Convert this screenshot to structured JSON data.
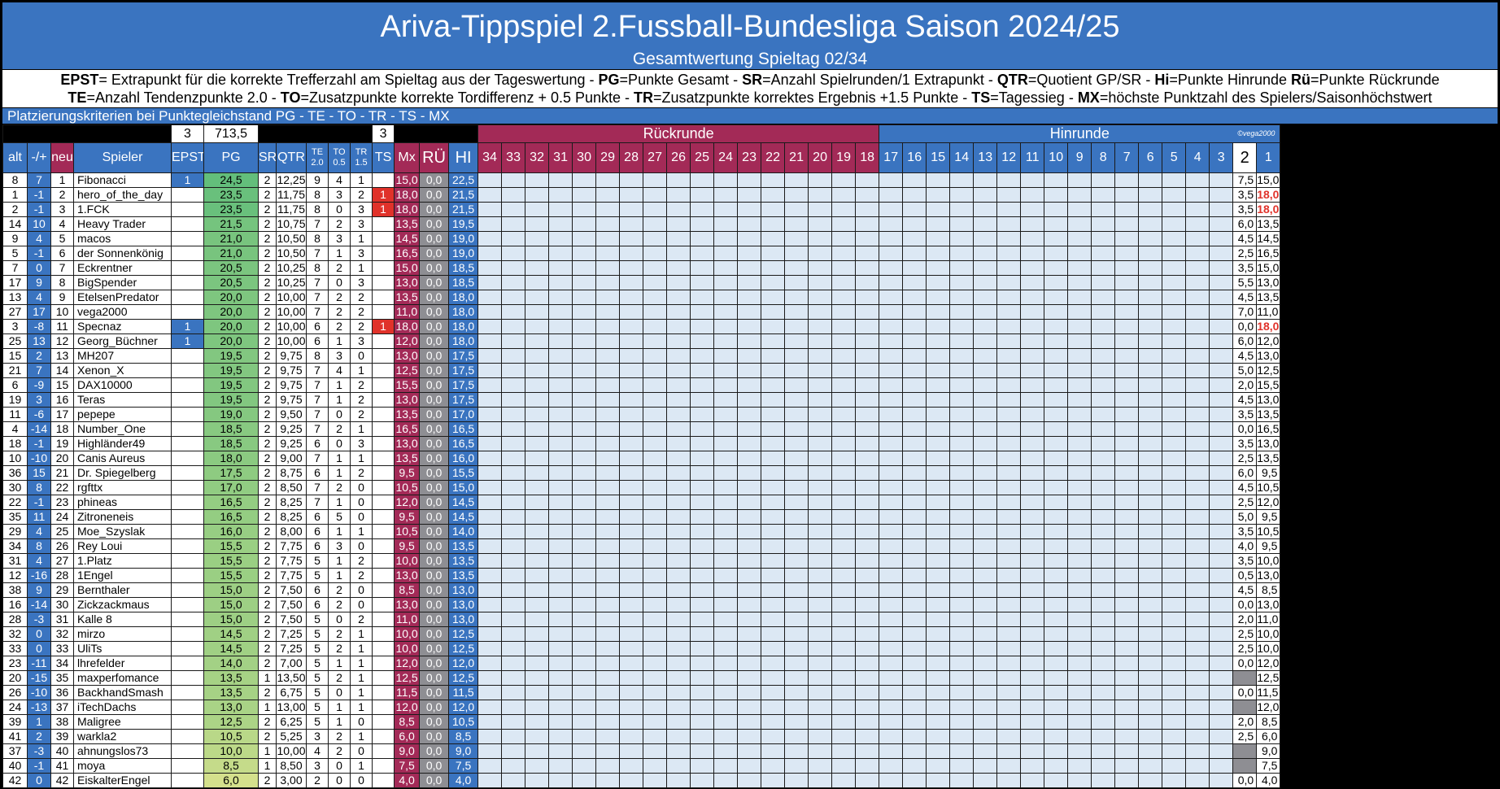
{
  "title": "Ariva-Tippspiel 2.Fussball-Bundesliga Saison 2024/25",
  "subtitle": "Gesamtwertung Spieltag 02/34",
  "legend_line1": [
    {
      "b": "EPST",
      "t": "= Extrapunkt für die korrekte Trefferzahl am Spieltag aus der Tageswertung - "
    },
    {
      "b": "PG",
      "t": "=Punkte Gesamt - "
    },
    {
      "b": "SR",
      "t": "=Anzahl Spielrunden/1 Extrapunkt - "
    },
    {
      "b": "QTR",
      "t": "=Quotient GP/SR - "
    },
    {
      "b": "Hi",
      "t": "=Punkte Hinrunde  "
    },
    {
      "b": "Rü",
      "t": "=Punkte Rückrunde"
    }
  ],
  "legend_line2": [
    {
      "b": "TE",
      "t": "=Anzahl Tendenzpunkte 2.0 - "
    },
    {
      "b": "TO",
      "t": "=Zusatzpunkte korrekte Tordifferenz + 0.5 Punkte - "
    },
    {
      "b": "TR",
      "t": "=Zusatzpunkte korrektes Ergebnis +1.5 Punkte - "
    },
    {
      "b": "TS",
      "t": "=Tagessieg - "
    },
    {
      "b": "MX",
      "t": "=höchste Punktzahl des Spielers/Saisonhöchstwert"
    }
  ],
  "criteria": "Platzierungskriterien bei Punktegleichstand  PG - TE - TO - TR - TS - MX",
  "totals": {
    "epst": "3",
    "pg": "713,5",
    "ts": "3",
    "rueckrunde": "Rückrunde",
    "hinrunde": "Hinrunde",
    "credit": "©vega2000"
  },
  "headers": {
    "alt": "alt",
    "pm": "-/+",
    "neu": "neu",
    "spieler": "Spieler",
    "epst": "EPST",
    "pg": "PG",
    "sr": "SR",
    "qtr": "QTR",
    "te_a": "TE",
    "te_b": "2.0",
    "to_a": "TO",
    "to_b": "0.5",
    "tr_a": "TR",
    "tr_b": "1.5",
    "ts": "TS",
    "mx": "Mx",
    "ru": "RÜ",
    "hi": "HI",
    "rounds_r": [
      "34",
      "33",
      "32",
      "31",
      "30",
      "29",
      "28",
      "27",
      "26",
      "25",
      "24",
      "23",
      "22",
      "21",
      "20",
      "19",
      "18"
    ],
    "rounds_h": [
      "17",
      "16",
      "15",
      "14",
      "13",
      "12",
      "11",
      "10",
      "9",
      "8",
      "7",
      "6",
      "5",
      "4",
      "3"
    ],
    "cur": "2",
    "one": "1"
  },
  "colors": {
    "blue": "#3a74c0",
    "maroon": "#a32a57",
    "gray": "#8e8e93",
    "red": "#e0322a",
    "light": "#dce8f4"
  },
  "rows": [
    {
      "alt": "8",
      "pm": "7",
      "neu": "1",
      "name": "Fibonacci",
      "epst": "1",
      "pg": "24,5",
      "sr": "2",
      "qtr": "12,25",
      "te": "9",
      "to": "4",
      "tr": "1",
      "ts": "",
      "mx": "15,0",
      "ru": "0,0",
      "hi": "22,5",
      "g2": "7,5",
      "g1": "15,0"
    },
    {
      "alt": "1",
      "pm": "-1",
      "neu": "2",
      "name": "hero_of_the_day",
      "epst": "",
      "pg": "23,5",
      "sr": "2",
      "qtr": "11,75",
      "te": "8",
      "to": "3",
      "tr": "2",
      "ts": "1",
      "mx": "18,0",
      "ru": "0,0",
      "hi": "21,5",
      "g2": "3,5",
      "g1": "18,0"
    },
    {
      "alt": "2",
      "pm": "-1",
      "neu": "3",
      "name": "1.FCK",
      "epst": "",
      "pg": "23,5",
      "sr": "2",
      "qtr": "11,75",
      "te": "8",
      "to": "0",
      "tr": "3",
      "ts": "1",
      "mx": "18,0",
      "ru": "0,0",
      "hi": "21,5",
      "g2": "3,5",
      "g1": "18,0"
    },
    {
      "alt": "14",
      "pm": "10",
      "neu": "4",
      "name": "Heavy Trader",
      "epst": "",
      "pg": "21,5",
      "sr": "2",
      "qtr": "10,75",
      "te": "7",
      "to": "2",
      "tr": "3",
      "ts": "",
      "mx": "13,5",
      "ru": "0,0",
      "hi": "19,5",
      "g2": "6,0",
      "g1": "13,5"
    },
    {
      "alt": "9",
      "pm": "4",
      "neu": "5",
      "name": "macos",
      "epst": "",
      "pg": "21,0",
      "sr": "2",
      "qtr": "10,50",
      "te": "8",
      "to": "3",
      "tr": "1",
      "ts": "",
      "mx": "14,5",
      "ru": "0,0",
      "hi": "19,0",
      "g2": "4,5",
      "g1": "14,5"
    },
    {
      "alt": "5",
      "pm": "-1",
      "neu": "6",
      "name": "der Sonnenkönig",
      "epst": "",
      "pg": "21,0",
      "sr": "2",
      "qtr": "10,50",
      "te": "7",
      "to": "1",
      "tr": "3",
      "ts": "",
      "mx": "16,5",
      "ru": "0,0",
      "hi": "19,0",
      "g2": "2,5",
      "g1": "16,5"
    },
    {
      "alt": "7",
      "pm": "0",
      "neu": "7",
      "name": "Eckrentner",
      "epst": "",
      "pg": "20,5",
      "sr": "2",
      "qtr": "10,25",
      "te": "8",
      "to": "2",
      "tr": "1",
      "ts": "",
      "mx": "15,0",
      "ru": "0,0",
      "hi": "18,5",
      "g2": "3,5",
      "g1": "15,0"
    },
    {
      "alt": "17",
      "pm": "9",
      "neu": "8",
      "name": "BigSpender",
      "epst": "",
      "pg": "20,5",
      "sr": "2",
      "qtr": "10,25",
      "te": "7",
      "to": "0",
      "tr": "3",
      "ts": "",
      "mx": "13,0",
      "ru": "0,0",
      "hi": "18,5",
      "g2": "5,5",
      "g1": "13,0"
    },
    {
      "alt": "13",
      "pm": "4",
      "neu": "9",
      "name": "EtelsenPredator",
      "epst": "",
      "pg": "20,0",
      "sr": "2",
      "qtr": "10,00",
      "te": "7",
      "to": "2",
      "tr": "2",
      "ts": "",
      "mx": "13,5",
      "ru": "0,0",
      "hi": "18,0",
      "g2": "4,5",
      "g1": "13,5"
    },
    {
      "alt": "27",
      "pm": "17",
      "neu": "10",
      "name": "vega2000",
      "epst": "",
      "pg": "20,0",
      "sr": "2",
      "qtr": "10,00",
      "te": "7",
      "to": "2",
      "tr": "2",
      "ts": "",
      "mx": "11,0",
      "ru": "0,0",
      "hi": "18,0",
      "g2": "7,0",
      "g1": "11,0"
    },
    {
      "alt": "3",
      "pm": "-8",
      "neu": "11",
      "name": "Specnaz",
      "epst": "1",
      "pg": "20,0",
      "sr": "2",
      "qtr": "10,00",
      "te": "6",
      "to": "2",
      "tr": "2",
      "ts": "1",
      "mx": "18,0",
      "ru": "0,0",
      "hi": "18,0",
      "g2": "0,0",
      "g1": "18,0"
    },
    {
      "alt": "25",
      "pm": "13",
      "neu": "12",
      "name": "Georg_Büchner",
      "epst": "1",
      "pg": "20,0",
      "sr": "2",
      "qtr": "10,00",
      "te": "6",
      "to": "1",
      "tr": "3",
      "ts": "",
      "mx": "12,0",
      "ru": "0,0",
      "hi": "18,0",
      "g2": "6,0",
      "g1": "12,0"
    },
    {
      "alt": "15",
      "pm": "2",
      "neu": "13",
      "name": "MH207",
      "epst": "",
      "pg": "19,5",
      "sr": "2",
      "qtr": "9,75",
      "te": "8",
      "to": "3",
      "tr": "0",
      "ts": "",
      "mx": "13,0",
      "ru": "0,0",
      "hi": "17,5",
      "g2": "4,5",
      "g1": "13,0"
    },
    {
      "alt": "21",
      "pm": "7",
      "neu": "14",
      "name": "Xenon_X",
      "epst": "",
      "pg": "19,5",
      "sr": "2",
      "qtr": "9,75",
      "te": "7",
      "to": "4",
      "tr": "1",
      "ts": "",
      "mx": "12,5",
      "ru": "0,0",
      "hi": "17,5",
      "g2": "5,0",
      "g1": "12,5"
    },
    {
      "alt": "6",
      "pm": "-9",
      "neu": "15",
      "name": "DAX10000",
      "epst": "",
      "pg": "19,5",
      "sr": "2",
      "qtr": "9,75",
      "te": "7",
      "to": "1",
      "tr": "2",
      "ts": "",
      "mx": "15,5",
      "ru": "0,0",
      "hi": "17,5",
      "g2": "2,0",
      "g1": "15,5"
    },
    {
      "alt": "19",
      "pm": "3",
      "neu": "16",
      "name": "Teras",
      "epst": "",
      "pg": "19,5",
      "sr": "2",
      "qtr": "9,75",
      "te": "7",
      "to": "1",
      "tr": "2",
      "ts": "",
      "mx": "13,0",
      "ru": "0,0",
      "hi": "17,5",
      "g2": "4,5",
      "g1": "13,0"
    },
    {
      "alt": "11",
      "pm": "-6",
      "neu": "17",
      "name": "pepepe",
      "epst": "",
      "pg": "19,0",
      "sr": "2",
      "qtr": "9,50",
      "te": "7",
      "to": "0",
      "tr": "2",
      "ts": "",
      "mx": "13,5",
      "ru": "0,0",
      "hi": "17,0",
      "g2": "3,5",
      "g1": "13,5"
    },
    {
      "alt": "4",
      "pm": "-14",
      "neu": "18",
      "name": "Number_One",
      "epst": "",
      "pg": "18,5",
      "sr": "2",
      "qtr": "9,25",
      "te": "7",
      "to": "2",
      "tr": "1",
      "ts": "",
      "mx": "16,5",
      "ru": "0,0",
      "hi": "16,5",
      "g2": "0,0",
      "g1": "16,5"
    },
    {
      "alt": "18",
      "pm": "-1",
      "neu": "19",
      "name": "Highländer49",
      "epst": "",
      "pg": "18,5",
      "sr": "2",
      "qtr": "9,25",
      "te": "6",
      "to": "0",
      "tr": "3",
      "ts": "",
      "mx": "13,0",
      "ru": "0,0",
      "hi": "16,5",
      "g2": "3,5",
      "g1": "13,0"
    },
    {
      "alt": "10",
      "pm": "-10",
      "neu": "20",
      "name": "Canis Aureus",
      "epst": "",
      "pg": "18,0",
      "sr": "2",
      "qtr": "9,00",
      "te": "7",
      "to": "1",
      "tr": "1",
      "ts": "",
      "mx": "13,5",
      "ru": "0,0",
      "hi": "16,0",
      "g2": "2,5",
      "g1": "13,5"
    },
    {
      "alt": "36",
      "pm": "15",
      "neu": "21",
      "name": "Dr. Spiegelberg",
      "epst": "",
      "pg": "17,5",
      "sr": "2",
      "qtr": "8,75",
      "te": "6",
      "to": "1",
      "tr": "2",
      "ts": "",
      "mx": "9,5",
      "ru": "0,0",
      "hi": "15,5",
      "g2": "6,0",
      "g1": "9,5"
    },
    {
      "alt": "30",
      "pm": "8",
      "neu": "22",
      "name": "rgfttx",
      "epst": "",
      "pg": "17,0",
      "sr": "2",
      "qtr": "8,50",
      "te": "7",
      "to": "2",
      "tr": "0",
      "ts": "",
      "mx": "10,5",
      "ru": "0,0",
      "hi": "15,0",
      "g2": "4,5",
      "g1": "10,5"
    },
    {
      "alt": "22",
      "pm": "-1",
      "neu": "23",
      "name": "phineas",
      "epst": "",
      "pg": "16,5",
      "sr": "2",
      "qtr": "8,25",
      "te": "7",
      "to": "1",
      "tr": "0",
      "ts": "",
      "mx": "12,0",
      "ru": "0,0",
      "hi": "14,5",
      "g2": "2,5",
      "g1": "12,0"
    },
    {
      "alt": "35",
      "pm": "11",
      "neu": "24",
      "name": "Zitroneneis",
      "epst": "",
      "pg": "16,5",
      "sr": "2",
      "qtr": "8,25",
      "te": "6",
      "to": "5",
      "tr": "0",
      "ts": "",
      "mx": "9,5",
      "ru": "0,0",
      "hi": "14,5",
      "g2": "5,0",
      "g1": "9,5"
    },
    {
      "alt": "29",
      "pm": "4",
      "neu": "25",
      "name": "Moe_Szyslak",
      "epst": "",
      "pg": "16,0",
      "sr": "2",
      "qtr": "8,00",
      "te": "6",
      "to": "1",
      "tr": "1",
      "ts": "",
      "mx": "10,5",
      "ru": "0,0",
      "hi": "14,0",
      "g2": "3,5",
      "g1": "10,5"
    },
    {
      "alt": "34",
      "pm": "8",
      "neu": "26",
      "name": "Rey Loui",
      "epst": "",
      "pg": "15,5",
      "sr": "2",
      "qtr": "7,75",
      "te": "6",
      "to": "3",
      "tr": "0",
      "ts": "",
      "mx": "9,5",
      "ru": "0,0",
      "hi": "13,5",
      "g2": "4,0",
      "g1": "9,5"
    },
    {
      "alt": "31",
      "pm": "4",
      "neu": "27",
      "name": "1.Platz",
      "epst": "",
      "pg": "15,5",
      "sr": "2",
      "qtr": "7,75",
      "te": "5",
      "to": "1",
      "tr": "2",
      "ts": "",
      "mx": "10,0",
      "ru": "0,0",
      "hi": "13,5",
      "g2": "3,5",
      "g1": "10,0"
    },
    {
      "alt": "12",
      "pm": "-16",
      "neu": "28",
      "name": "1Engel",
      "epst": "",
      "pg": "15,5",
      "sr": "2",
      "qtr": "7,75",
      "te": "5",
      "to": "1",
      "tr": "2",
      "ts": "",
      "mx": "13,0",
      "ru": "0,0",
      "hi": "13,5",
      "g2": "0,5",
      "g1": "13,0"
    },
    {
      "alt": "38",
      "pm": "9",
      "neu": "29",
      "name": "Bernthaler",
      "epst": "",
      "pg": "15,0",
      "sr": "2",
      "qtr": "7,50",
      "te": "6",
      "to": "2",
      "tr": "0",
      "ts": "",
      "mx": "8,5",
      "ru": "0,0",
      "hi": "13,0",
      "g2": "4,5",
      "g1": "8,5"
    },
    {
      "alt": "16",
      "pm": "-14",
      "neu": "30",
      "name": "Zickzackmaus",
      "epst": "",
      "pg": "15,0",
      "sr": "2",
      "qtr": "7,50",
      "te": "6",
      "to": "2",
      "tr": "0",
      "ts": "",
      "mx": "13,0",
      "ru": "0,0",
      "hi": "13,0",
      "g2": "0,0",
      "g1": "13,0"
    },
    {
      "alt": "28",
      "pm": "-3",
      "neu": "31",
      "name": "Kalle 8",
      "epst": "",
      "pg": "15,0",
      "sr": "2",
      "qtr": "7,50",
      "te": "5",
      "to": "0",
      "tr": "2",
      "ts": "",
      "mx": "11,0",
      "ru": "0,0",
      "hi": "13,0",
      "g2": "2,0",
      "g1": "11,0"
    },
    {
      "alt": "32",
      "pm": "0",
      "neu": "32",
      "name": "mirzo",
      "epst": "",
      "pg": "14,5",
      "sr": "2",
      "qtr": "7,25",
      "te": "5",
      "to": "2",
      "tr": "1",
      "ts": "",
      "mx": "10,0",
      "ru": "0,0",
      "hi": "12,5",
      "g2": "2,5",
      "g1": "10,0"
    },
    {
      "alt": "33",
      "pm": "0",
      "neu": "33",
      "name": "UliTs",
      "epst": "",
      "pg": "14,5",
      "sr": "2",
      "qtr": "7,25",
      "te": "5",
      "to": "2",
      "tr": "1",
      "ts": "",
      "mx": "10,0",
      "ru": "0,0",
      "hi": "12,5",
      "g2": "2,5",
      "g1": "10,0"
    },
    {
      "alt": "23",
      "pm": "-11",
      "neu": "34",
      "name": "lhrefelder",
      "epst": "",
      "pg": "14,0",
      "sr": "2",
      "qtr": "7,00",
      "te": "5",
      "to": "1",
      "tr": "1",
      "ts": "",
      "mx": "12,0",
      "ru": "0,0",
      "hi": "12,0",
      "g2": "0,0",
      "g1": "12,0"
    },
    {
      "alt": "20",
      "pm": "-15",
      "neu": "35",
      "name": "maxperfomance",
      "epst": "",
      "pg": "13,5",
      "sr": "1",
      "qtr": "13,50",
      "te": "5",
      "to": "2",
      "tr": "1",
      "ts": "",
      "mx": "12,5",
      "ru": "0,0",
      "hi": "12,5",
      "g2": "",
      "g1": "12,5"
    },
    {
      "alt": "26",
      "pm": "-10",
      "neu": "36",
      "name": "BackhandSmash",
      "epst": "",
      "pg": "13,5",
      "sr": "2",
      "qtr": "6,75",
      "te": "5",
      "to": "0",
      "tr": "1",
      "ts": "",
      "mx": "11,5",
      "ru": "0,0",
      "hi": "11,5",
      "g2": "0,0",
      "g1": "11,5"
    },
    {
      "alt": "24",
      "pm": "-13",
      "neu": "37",
      "name": "iTechDachs",
      "epst": "",
      "pg": "13,0",
      "sr": "1",
      "qtr": "13,00",
      "te": "5",
      "to": "1",
      "tr": "1",
      "ts": "",
      "mx": "12,0",
      "ru": "0,0",
      "hi": "12,0",
      "g2": "",
      "g1": "12,0"
    },
    {
      "alt": "39",
      "pm": "1",
      "neu": "38",
      "name": "Maligree",
      "epst": "",
      "pg": "12,5",
      "sr": "2",
      "qtr": "6,25",
      "te": "5",
      "to": "1",
      "tr": "0",
      "ts": "",
      "mx": "8,5",
      "ru": "0,0",
      "hi": "10,5",
      "g2": "2,0",
      "g1": "8,5"
    },
    {
      "alt": "41",
      "pm": "2",
      "neu": "39",
      "name": "warkla2",
      "epst": "",
      "pg": "10,5",
      "sr": "2",
      "qtr": "5,25",
      "te": "3",
      "to": "2",
      "tr": "1",
      "ts": "",
      "mx": "6,0",
      "ru": "0,0",
      "hi": "8,5",
      "g2": "2,5",
      "g1": "6,0"
    },
    {
      "alt": "37",
      "pm": "-3",
      "neu": "40",
      "name": "ahnungslos73",
      "epst": "",
      "pg": "10,0",
      "sr": "1",
      "qtr": "10,00",
      "te": "4",
      "to": "2",
      "tr": "0",
      "ts": "",
      "mx": "9,0",
      "ru": "0,0",
      "hi": "9,0",
      "g2": "",
      "g1": "9,0"
    },
    {
      "alt": "40",
      "pm": "-1",
      "neu": "41",
      "name": "moya",
      "epst": "",
      "pg": "8,5",
      "sr": "1",
      "qtr": "8,50",
      "te": "3",
      "to": "0",
      "tr": "1",
      "ts": "",
      "mx": "7,5",
      "ru": "0,0",
      "hi": "7,5",
      "g2": "",
      "g1": "7,5"
    },
    {
      "alt": "42",
      "pm": "0",
      "neu": "42",
      "name": "EiskalterEngel",
      "epst": "",
      "pg": "6,0",
      "sr": "2",
      "qtr": "3,00",
      "te": "2",
      "to": "0",
      "tr": "0",
      "ts": "",
      "mx": "4,0",
      "ru": "0,0",
      "hi": "4,0",
      "g2": "0,0",
      "g1": "4,0"
    }
  ]
}
